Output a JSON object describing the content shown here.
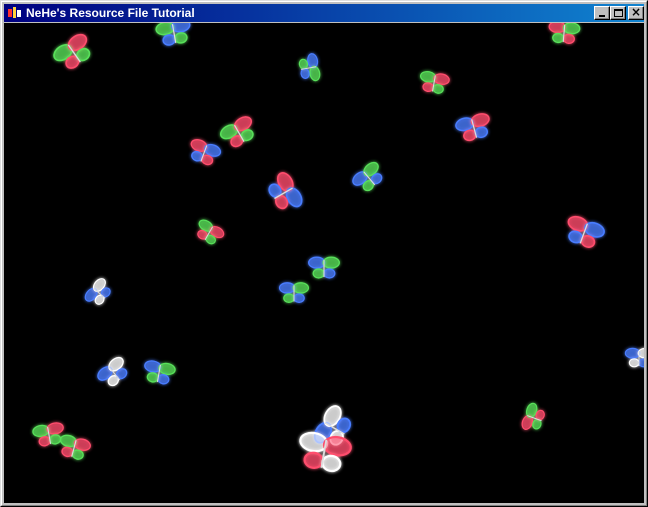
{
  "window": {
    "title": "NeHe's Resource File Tutorial",
    "minimize_label": "",
    "maximize_label": "",
    "close_label": "×"
  },
  "scene": {
    "background_color": "#000000",
    "butterfly_palette": [
      "#ff4d6d",
      "#4a7dff",
      "#59e05a",
      "#ffffff"
    ]
  }
}
